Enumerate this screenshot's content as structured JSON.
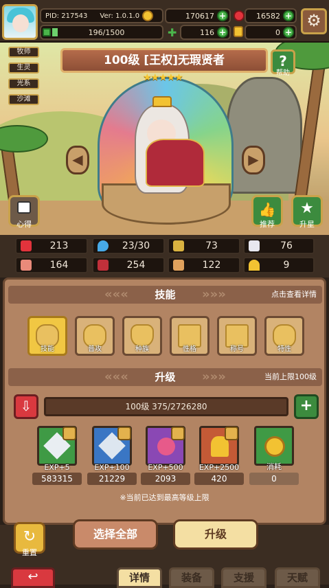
{
  "player": {
    "pid": "PID: 217543",
    "version": "Ver: 1.0.1.0",
    "exp": "196/1500"
  },
  "currency": {
    "gold": "170617",
    "ruby": "16582",
    "clover": "116",
    "key": "0"
  },
  "tags": [
    "牧师",
    "生灵",
    "光系",
    "沙滩"
  ],
  "hero": {
    "title": "100级 [王权]无瑕贤者",
    "stars": "★★★★★",
    "help_label": "帮助"
  },
  "side_buttons": {
    "left": "心得",
    "recommend": "推荐",
    "star_up": "升星"
  },
  "stats": [
    {
      "icon": "heart-icon",
      "value": "213"
    },
    {
      "icon": "drop-icon",
      "value": "23/30"
    },
    {
      "icon": "shield-icon",
      "value": "73"
    },
    {
      "icon": "wing-icon",
      "value": "76"
    },
    {
      "icon": "fist-icon",
      "value": "164"
    },
    {
      "icon": "book-icon",
      "value": "254"
    },
    {
      "icon": "boot-icon",
      "value": "122"
    },
    {
      "icon": "horseshoe-icon",
      "value": "9"
    }
  ],
  "skills_section": {
    "title": "技能",
    "right": "点击查看详情"
  },
  "skills": [
    "技能",
    "普攻",
    "种族",
    "性格",
    "称号",
    "特性"
  ],
  "upgrade_section": {
    "title": "升级",
    "right": "当前上限100级"
  },
  "level_bar": "100级  375/2726280",
  "items": [
    {
      "label": "EXP+5",
      "count": "583315"
    },
    {
      "label": "EXP+100",
      "count": "21229"
    },
    {
      "label": "EXP+500",
      "count": "2093"
    },
    {
      "label": "EXP+2500",
      "count": "420"
    },
    {
      "label": "消耗",
      "count": "0"
    }
  ],
  "note": "※当前已达到最高等级上限",
  "actions": {
    "reset": "重置",
    "select_all": "选择全部",
    "upgrade": "升级"
  },
  "tabs": [
    "详情",
    "装备",
    "支援",
    "天赋"
  ],
  "colors": {
    "gold": "#f2c232",
    "green": "#4bb54b",
    "panel": "#b28463",
    "dark": "#3b2d22"
  }
}
